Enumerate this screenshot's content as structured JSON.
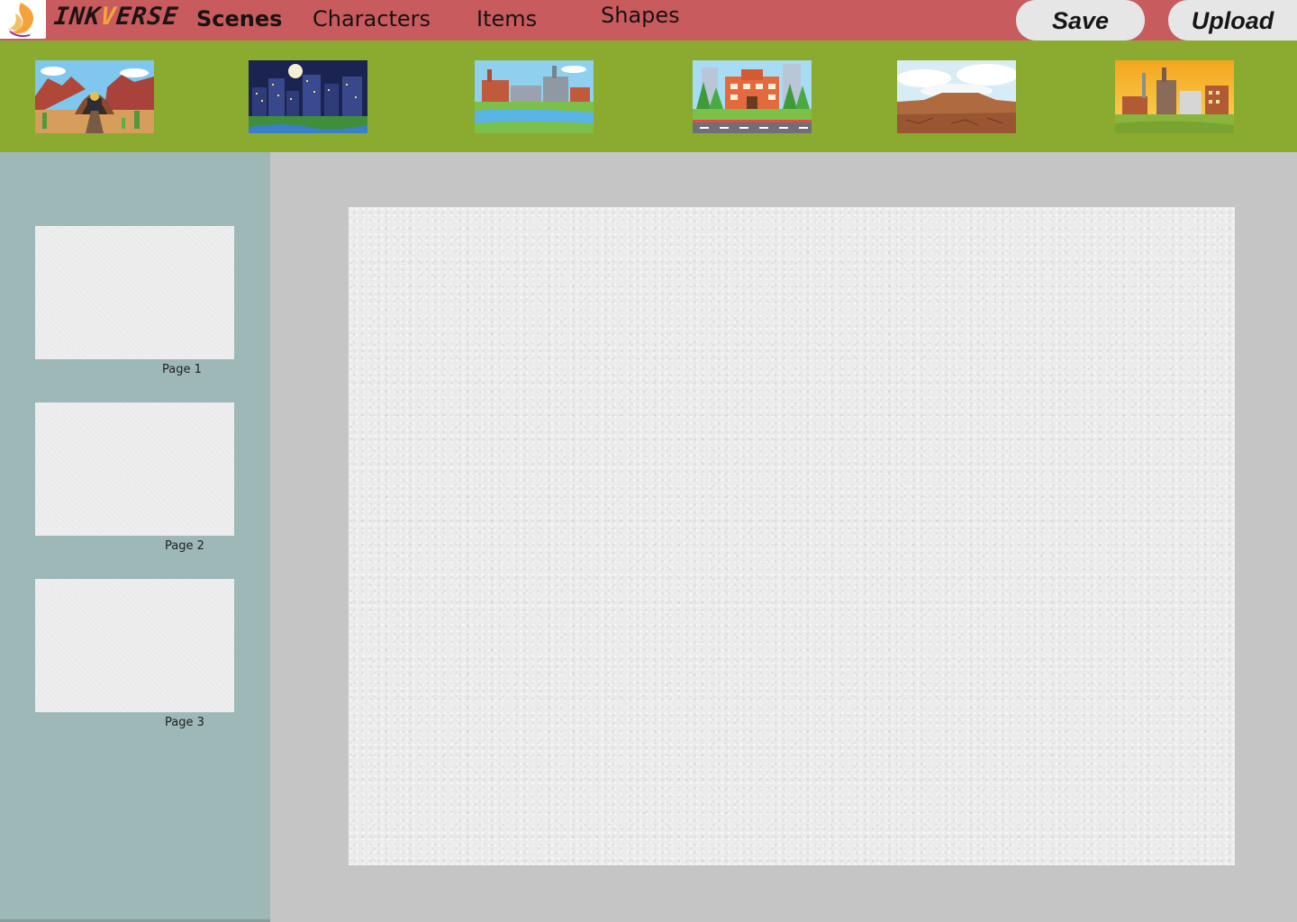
{
  "app": {
    "brand_parts": [
      "INK",
      "V",
      "ERSE"
    ]
  },
  "nav": {
    "scenes": "Scenes",
    "characters": "Characters",
    "items": "Items",
    "shapes": "Shapes"
  },
  "actions": {
    "save": "Save",
    "upload": "Upload"
  },
  "scenes": [
    {
      "name": "desert-train-scene"
    },
    {
      "name": "night-city-scene"
    },
    {
      "name": "factory-river-scene"
    },
    {
      "name": "school-scene"
    },
    {
      "name": "dry-land-scene"
    },
    {
      "name": "industrial-sunset-scene"
    }
  ],
  "pages": [
    {
      "label": "Page 1"
    },
    {
      "label": "Page 2"
    },
    {
      "label": "Page 3"
    }
  ],
  "colors": {
    "topbar": "#c85b5e",
    "scene_strip": "#8aaa30",
    "side_panel": "#9eb8b8",
    "workspace": "#c6c5c6",
    "pill": "#e6e6e6"
  }
}
